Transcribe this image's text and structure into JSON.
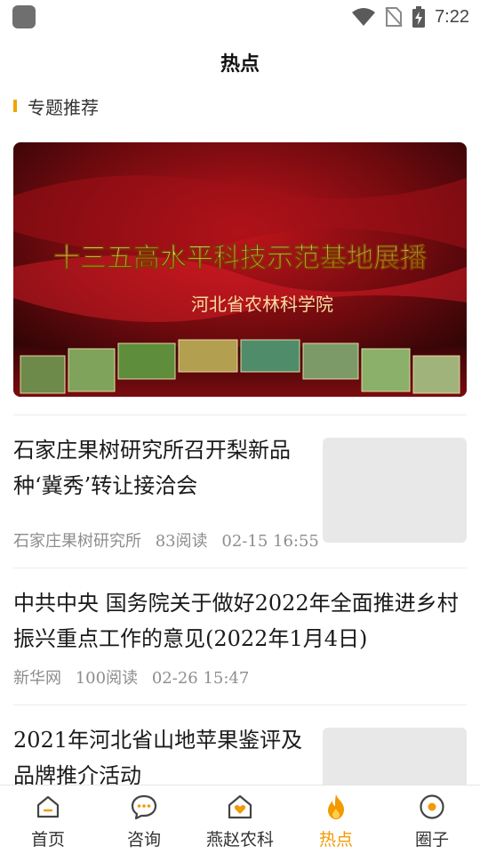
{
  "status_bar": {
    "time": "7:22"
  },
  "header": {
    "title": "热点"
  },
  "section": {
    "label": "专题推荐"
  },
  "banner": {
    "title": "十三五高水平科技示范基地展播",
    "subtitle": "河北省农林科学院"
  },
  "articles": [
    {
      "title_line1": "石家庄果树研究所召开梨新品",
      "title_line2": "种‘冀秀’转让接洽会",
      "source": "石家庄果树研究所",
      "reads": "83阅读",
      "time": "02-15 16:55"
    },
    {
      "title_line1": "中共中央 国务院关于做好2022年全面推进乡村",
      "title_line2": "振兴重点工作的意见(2022年1月4日)",
      "source": "新华网",
      "reads": "100阅读",
      "time": "02-26 15:47"
    },
    {
      "title_line1": "2021年河北省山地苹果鉴评及",
      "title_line2": "品牌推介活动"
    }
  ],
  "nav": {
    "items": [
      {
        "label": "首页",
        "icon": "home-icon"
      },
      {
        "label": "咨询",
        "icon": "chat-icon"
      },
      {
        "label": "燕赵农科",
        "icon": "heart-house-icon"
      },
      {
        "label": "热点",
        "icon": "flame-icon"
      },
      {
        "label": "圈子",
        "icon": "circle-icon"
      }
    ],
    "active_color": "#f39a00",
    "inactive_color": "#333333"
  }
}
